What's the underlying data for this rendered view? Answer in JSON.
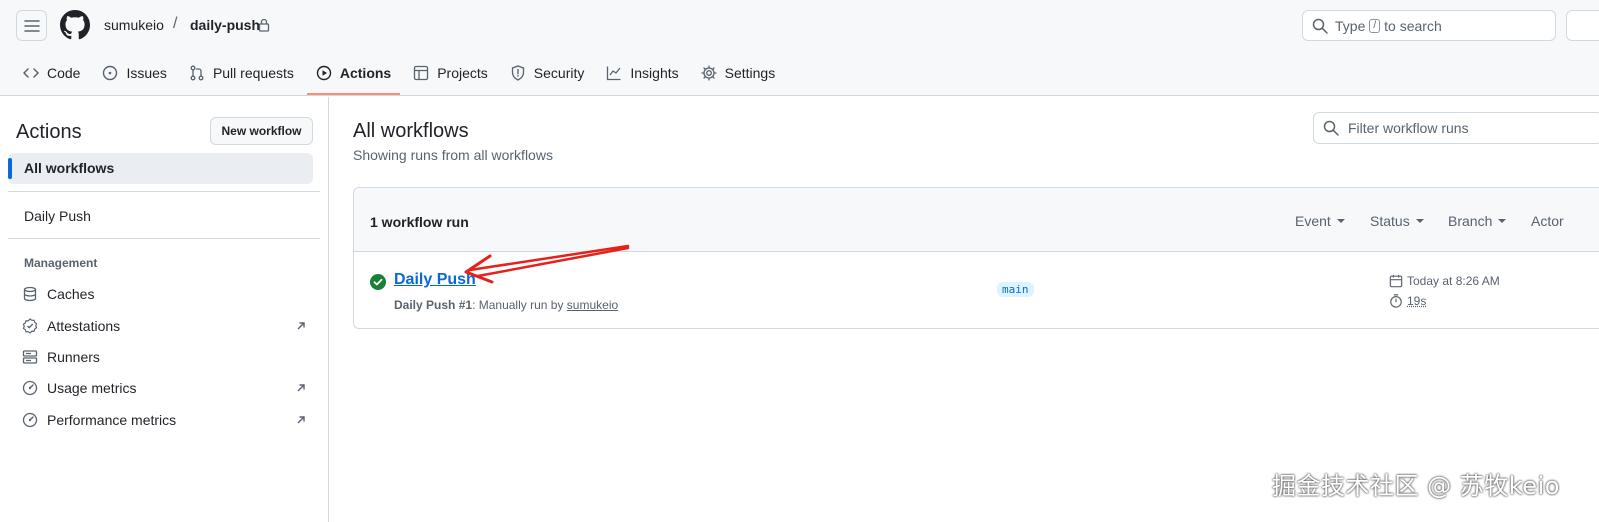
{
  "header": {
    "owner": "sumukeio",
    "separator": "/",
    "repo": "daily-push",
    "search": {
      "prefix": "Type",
      "key": "/",
      "suffix": "to search"
    }
  },
  "tabs": [
    {
      "label": "Code",
      "icon": "code-icon"
    },
    {
      "label": "Issues",
      "icon": "issue-icon"
    },
    {
      "label": "Pull requests",
      "icon": "pull-request-icon"
    },
    {
      "label": "Actions",
      "icon": "play-icon",
      "active": true
    },
    {
      "label": "Projects",
      "icon": "table-icon"
    },
    {
      "label": "Security",
      "icon": "shield-icon"
    },
    {
      "label": "Insights",
      "icon": "graph-icon"
    },
    {
      "label": "Settings",
      "icon": "gear-icon"
    }
  ],
  "sidebar": {
    "title": "Actions",
    "new_workflow": "New workflow",
    "all_workflows": "All workflows",
    "workflows": [
      "Daily Push"
    ],
    "management_heading": "Management",
    "management": [
      {
        "label": "Caches",
        "icon": "database-icon",
        "external": false
      },
      {
        "label": "Attestations",
        "icon": "verified-icon",
        "external": true
      },
      {
        "label": "Runners",
        "icon": "server-icon",
        "external": false
      },
      {
        "label": "Usage metrics",
        "icon": "meter-icon",
        "external": true
      },
      {
        "label": "Performance metrics",
        "icon": "meter-icon",
        "external": true
      }
    ]
  },
  "main": {
    "title": "All workflows",
    "subtitle": "Showing runs from all workflows",
    "filter_placeholder": "Filter workflow runs",
    "run_count": "1 workflow run",
    "filters": [
      "Event",
      "Status",
      "Branch",
      "Actor"
    ],
    "run": {
      "name": "Daily Push",
      "workflow": "Daily Push",
      "number": "#1",
      "trigger_text": ": Manually run by",
      "actor": "sumukeio",
      "branch": "main",
      "date": "Today at 8:26 AM",
      "duration": "19s",
      "status_color": "#1a7f37"
    }
  },
  "annotation": {
    "arrow_color": "#e8201a"
  },
  "watermark": "掘金技术社区 @ 苏牧keio"
}
